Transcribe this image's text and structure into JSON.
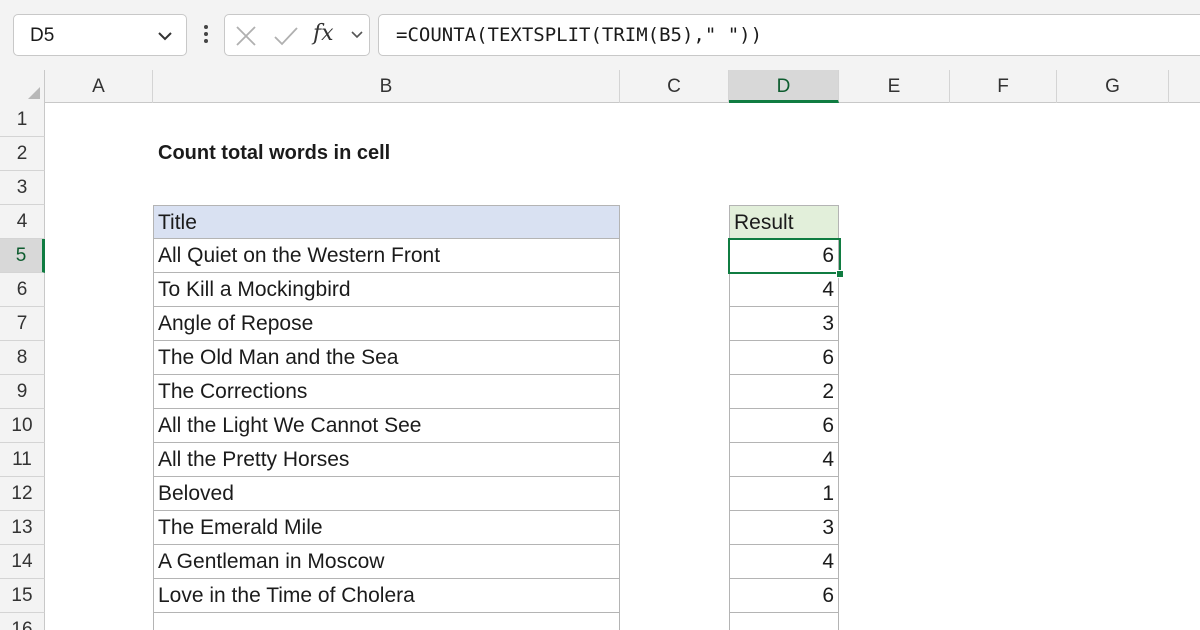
{
  "formula_bar": {
    "name_box": "D5",
    "formula": "=COUNTA(TEXTSPLIT(TRIM(B5),\" \"))",
    "fx_label": "fx"
  },
  "columns": [
    "A",
    "B",
    "C",
    "D",
    "E",
    "F",
    "G"
  ],
  "active_column": "D",
  "rows": [
    "1",
    "2",
    "3",
    "4",
    "5",
    "6",
    "7",
    "8",
    "9",
    "10",
    "11",
    "12",
    "13",
    "14",
    "15",
    "16"
  ],
  "active_row": "5",
  "sheet": {
    "title": "Count total words in cell",
    "table_header": "Title",
    "result_header": "Result",
    "records": [
      {
        "title": "All Quiet on the Western Front",
        "result": "6"
      },
      {
        "title": "To Kill a Mockingbird",
        "result": "4"
      },
      {
        "title": "Angle of Repose",
        "result": "3"
      },
      {
        "title": "The Old Man and the Sea",
        "result": "6"
      },
      {
        "title": "The Corrections",
        "result": "2"
      },
      {
        "title": "All the Light We Cannot See",
        "result": "6"
      },
      {
        "title": "All the Pretty Horses",
        "result": "4"
      },
      {
        "title": "Beloved",
        "result": "1"
      },
      {
        "title": "The Emerald Mile",
        "result": "3"
      },
      {
        "title": "A Gentleman in Moscow",
        "result": "4"
      },
      {
        "title": "Love in the Time of Cholera",
        "result": "6"
      }
    ]
  },
  "colors": {
    "accent": "#107c41",
    "title_header_fill": "#d9e1f2",
    "result_header_fill": "#e2efda"
  }
}
